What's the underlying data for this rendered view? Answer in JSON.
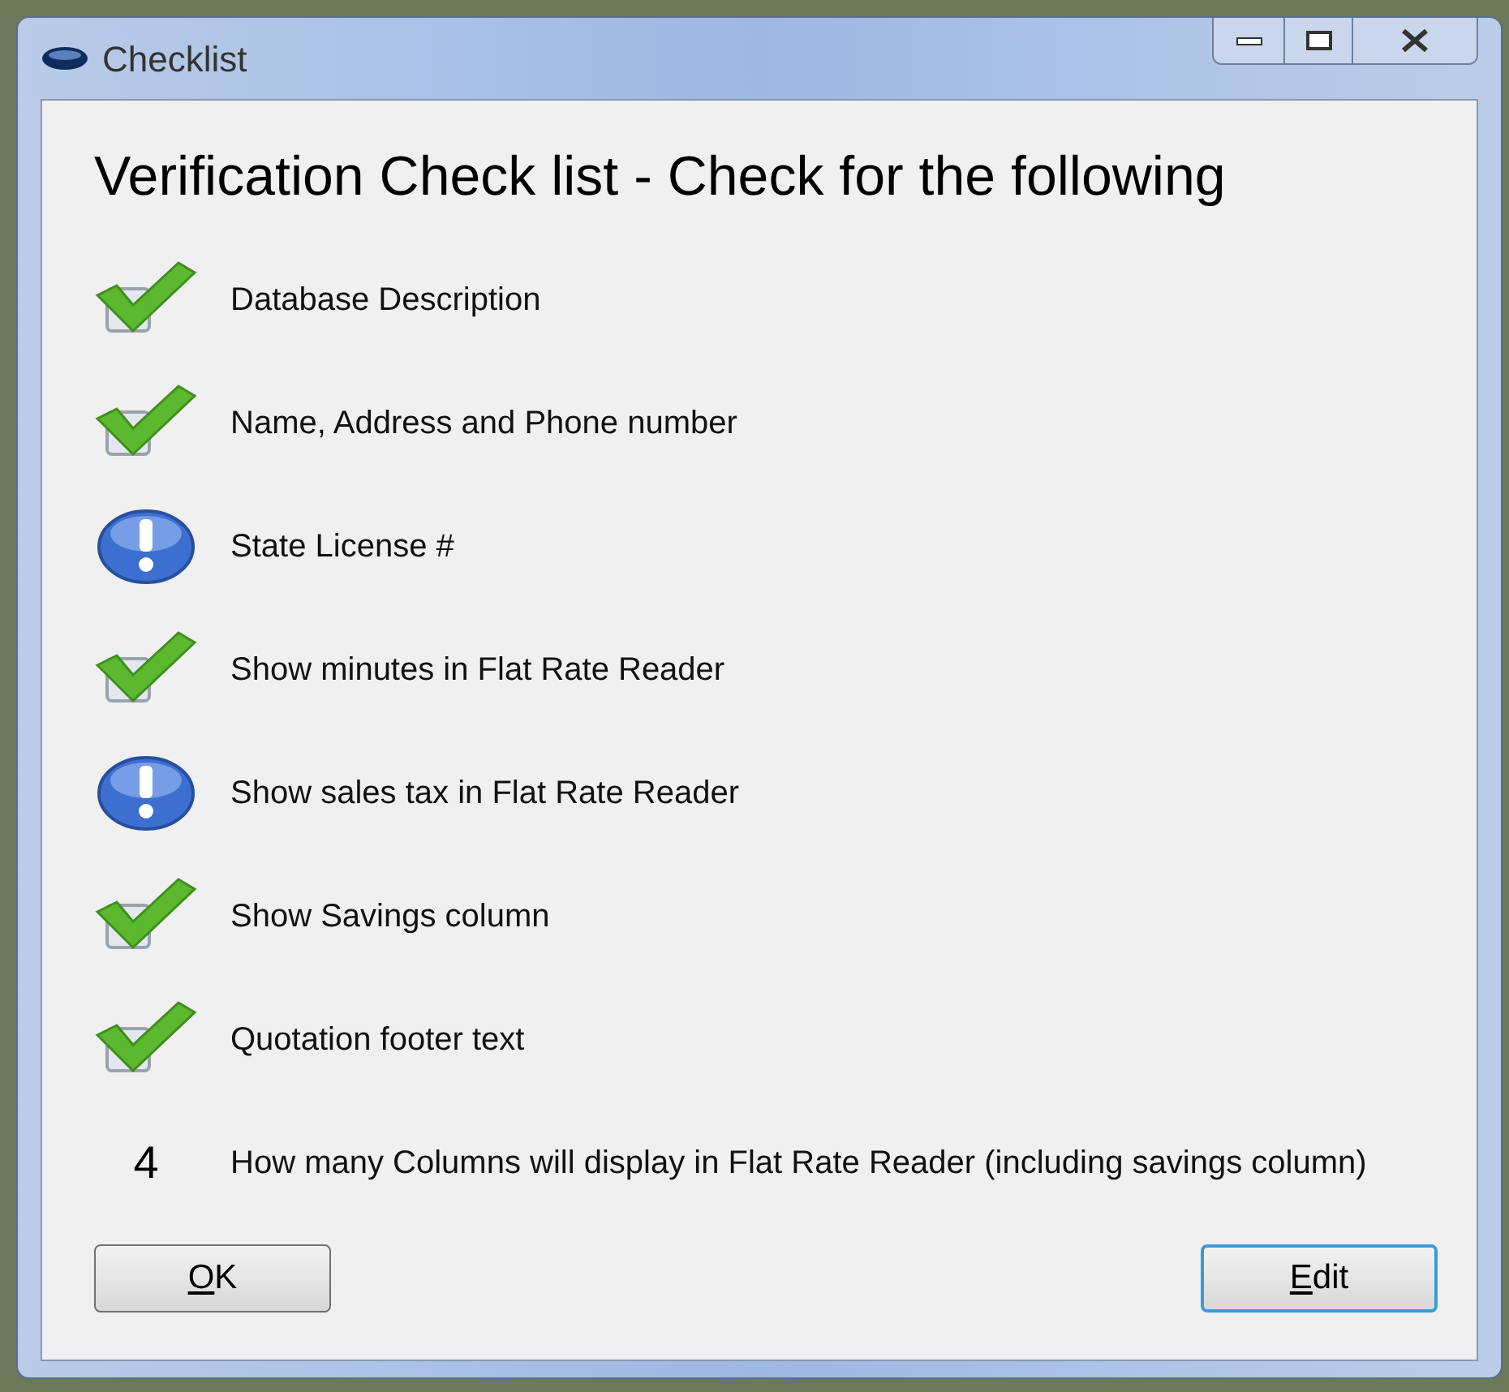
{
  "window": {
    "title": "Checklist"
  },
  "heading": "Verification Check list - Check for the following",
  "items": [
    {
      "kind": "check",
      "label": "Database Description"
    },
    {
      "kind": "check",
      "label": "Name, Address and Phone number"
    },
    {
      "kind": "warning",
      "label": "State License #"
    },
    {
      "kind": "check",
      "label": "Show minutes in Flat Rate Reader"
    },
    {
      "kind": "warning",
      "label": "Show sales tax in Flat Rate Reader"
    },
    {
      "kind": "check",
      "label": "Show Savings column"
    },
    {
      "kind": "check",
      "label": "Quotation footer text"
    },
    {
      "kind": "count",
      "value": "4",
      "label": "How many Columns will display in Flat Rate Reader (including savings column)"
    }
  ],
  "buttons": [
    {
      "access_key": "O",
      "label_rest": "K",
      "selected": false
    },
    {
      "access_key": "E",
      "label_rest": "dit",
      "selected": true
    }
  ]
}
